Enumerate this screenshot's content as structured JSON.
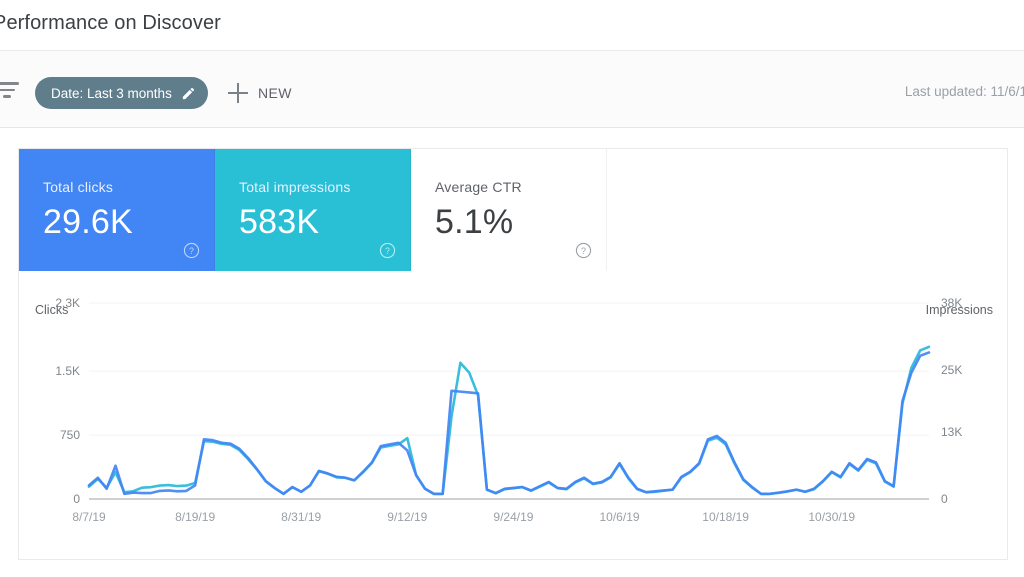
{
  "header": {
    "title": "Performance on Discover"
  },
  "toolbar": {
    "filter_icon": "filter-icon",
    "date_chip_label": "Date: Last 3 months",
    "edit_icon": "pencil-icon",
    "new_button_label": "NEW",
    "plus_icon": "plus-icon",
    "last_updated": "Last updated: 11/6/1"
  },
  "metrics": [
    {
      "label": "Total clicks",
      "value": "29.6K",
      "color": "#4285f4",
      "help_icon": "help-circle-icon"
    },
    {
      "label": "Total impressions",
      "value": "583K",
      "color": "#29c0d6",
      "help_icon": "help-circle-icon"
    },
    {
      "label": "Average CTR",
      "value": "5.1%",
      "color": "#ffffff",
      "help_icon": "help-circle-icon"
    }
  ],
  "chart_data": {
    "type": "line",
    "title": "",
    "xlabel": "",
    "ylabel": "Clicks",
    "y2label": "Impressions",
    "ylim": [
      0,
      2300
    ],
    "y2lim": [
      0,
      38000
    ],
    "ytick_labels": [
      "2.3K",
      "1.5K",
      "750",
      "0"
    ],
    "ytick_values": [
      2300,
      1500,
      750,
      0
    ],
    "y2tick_labels": [
      "38K",
      "25K",
      "13K",
      "0"
    ],
    "y2tick_values": [
      38000,
      25000,
      13000,
      0
    ],
    "xtick_labels": [
      "8/7/19",
      "8/19/19",
      "8/31/19",
      "9/12/19",
      "9/24/19",
      "10/6/19",
      "10/18/19",
      "10/30/19"
    ],
    "xtick_indices": [
      0,
      12,
      24,
      36,
      48,
      60,
      72,
      84
    ],
    "grid": true,
    "legend": "none",
    "colors": {
      "clicks": "#4285f4",
      "impressions": "#2ab9d9"
    },
    "series": [
      {
        "name": "Clicks",
        "axis": "left",
        "color": "#4285f4",
        "values": [
          160,
          250,
          120,
          390,
          60,
          75,
          70,
          70,
          95,
          100,
          90,
          95,
          160,
          700,
          690,
          660,
          650,
          590,
          480,
          350,
          210,
          130,
          60,
          140,
          85,
          160,
          330,
          300,
          260,
          250,
          220,
          320,
          430,
          620,
          640,
          660,
          570,
          280,
          120,
          60,
          60,
          1270,
          1260,
          1250,
          1240,
          110,
          70,
          120,
          130,
          140,
          100,
          150,
          200,
          130,
          120,
          200,
          250,
          180,
          200,
          260,
          420,
          250,
          120,
          80,
          90,
          100,
          110,
          260,
          320,
          420,
          700,
          740,
          660,
          430,
          230,
          140,
          60,
          60,
          75,
          90,
          110,
          85,
          120,
          210,
          320,
          260,
          420,
          340,
          470,
          430,
          210,
          150,
          1150,
          1480,
          1680,
          1720
        ]
      },
      {
        "name": "Impressions",
        "axis": "right",
        "color": "#2ab9d9",
        "values": [
          2400,
          3900,
          2200,
          5200,
          1300,
          1500,
          2200,
          2300,
          2600,
          2700,
          2500,
          2600,
          3100,
          11200,
          11100,
          10700,
          10500,
          9500,
          7700,
          5700,
          3400,
          2100,
          1000,
          2300,
          1400,
          2600,
          5400,
          4900,
          4200,
          4100,
          3600,
          5200,
          7000,
          10000,
          10300,
          10600,
          11800,
          4600,
          2000,
          1000,
          1000,
          16000,
          26400,
          24500,
          20100,
          1800,
          1100,
          1900,
          2100,
          2300,
          1600,
          2400,
          3200,
          2100,
          1900,
          3200,
          4000,
          2900,
          3200,
          4200,
          6800,
          4000,
          1900,
          1300,
          1400,
          1600,
          1800,
          4200,
          5200,
          6800,
          11300,
          11900,
          10600,
          6900,
          3700,
          2200,
          1000,
          1000,
          1200,
          1450,
          1800,
          1400,
          1900,
          3400,
          5200,
          4200,
          6800,
          5500,
          7600,
          6900,
          3400,
          2400,
          18500,
          25400,
          28800,
          29500
        ]
      }
    ]
  }
}
